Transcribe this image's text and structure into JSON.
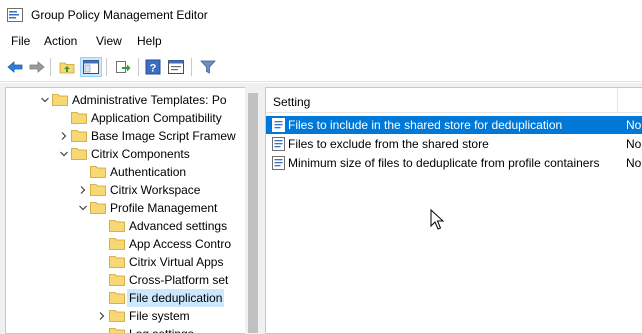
{
  "window": {
    "title": "Group Policy Management Editor"
  },
  "menu": {
    "items": [
      {
        "label": "File"
      },
      {
        "label": "Action"
      },
      {
        "label": "View"
      },
      {
        "label": "Help"
      }
    ]
  },
  "toolbar": {
    "buttons": [
      {
        "icon": "back-arrow-icon"
      },
      {
        "icon": "forward-arrow-icon"
      },
      {
        "icon": "up-folder-icon"
      },
      {
        "icon": "show-hide-tree-icon"
      },
      {
        "icon": "export-list-icon"
      },
      {
        "icon": "help-icon"
      },
      {
        "icon": "properties-icon"
      },
      {
        "icon": "filter-icon"
      }
    ]
  },
  "tree": {
    "items": [
      {
        "label": "Administrative Templates: Po",
        "expanded": true
      },
      {
        "label": "Application Compatibility",
        "expanded": null
      },
      {
        "label": "Base Image Script Framew",
        "expanded": false
      },
      {
        "label": "Citrix Components",
        "expanded": true
      },
      {
        "label": "Authentication",
        "expanded": null
      },
      {
        "label": "Citrix Workspace",
        "expanded": false
      },
      {
        "label": "Profile Management",
        "expanded": true
      },
      {
        "label": "Advanced settings",
        "expanded": null
      },
      {
        "label": "App Access Contro",
        "expanded": null
      },
      {
        "label": "Citrix Virtual Apps",
        "expanded": null
      },
      {
        "label": "Cross-Platform set",
        "expanded": null
      },
      {
        "label": "File deduplication",
        "expanded": null,
        "selected": true
      },
      {
        "label": "File system",
        "expanded": false
      },
      {
        "label": "Log settings",
        "expanded": null
      }
    ]
  },
  "list": {
    "column_header": "Setting",
    "rows": [
      {
        "label": "Files to include in the shared store for deduplication",
        "state": "No",
        "selected": true
      },
      {
        "label": "Files to exclude from the shared store",
        "state": "No"
      },
      {
        "label": "Minimum size of files to deduplicate from profile containers",
        "state": "No"
      }
    ]
  },
  "colors": {
    "selection_blue": "#0078d7",
    "tree_selection": "#cce8ff",
    "folder_yellow": "#f8d775"
  }
}
